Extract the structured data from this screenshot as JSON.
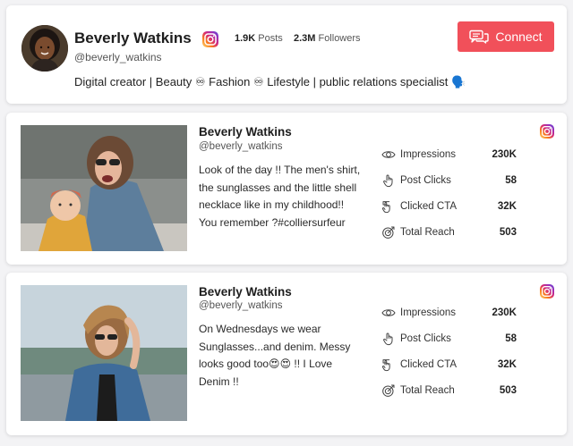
{
  "profile": {
    "name": "Beverly Watkins",
    "handle": "@beverly_watkins",
    "posts_count": "1.9K",
    "posts_label": "Posts",
    "followers_count": "2.3M",
    "followers_label": "Followers",
    "connect_label": "Connect",
    "bio": "Digital creator | Beauty ♾ Fashion ♾ Lifestyle | public relations specialist 🗣️",
    "platform_icon": "instagram-icon",
    "accent_color": "#f1505a"
  },
  "metric_labels": {
    "impressions": "Impressions",
    "post_clicks": "Post Clicks",
    "clicked_cta": "Clicked CTA",
    "total_reach": "Total Reach"
  },
  "posts": [
    {
      "name": "Beverly Watkins",
      "handle": "@beverly_watkins",
      "text": "Look of the day !! The men's shirt, the sunglasses and the little shell necklace like in my childhood!! You remember ?#colliersurfeur",
      "impressions": "230K",
      "post_clicks": "58",
      "clicked_cta": "32K",
      "total_reach": "503"
    },
    {
      "name": "Beverly Watkins",
      "handle": "@beverly_watkins",
      "text": "On Wednesdays we wear Sunglasses...and denim. Messy looks good too😍😍 !! I Love Denim !!",
      "impressions": "230K",
      "post_clicks": "58",
      "clicked_cta": "32K",
      "total_reach": "503"
    }
  ]
}
